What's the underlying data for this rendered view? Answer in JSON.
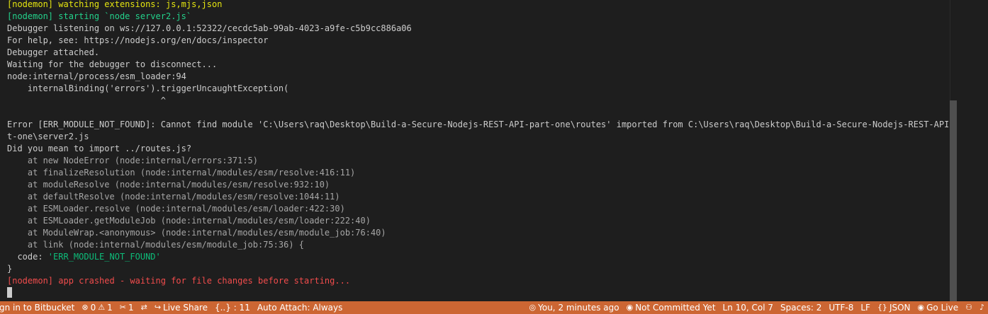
{
  "terminal": {
    "lines": [
      {
        "text": "[nodemon] watching extensions: js,mjs,json",
        "color": "#e5e510"
      },
      {
        "text": "[nodemon] starting `node server2.js`",
        "color": "#23d18b"
      },
      {
        "text": "Debugger listening on ws://127.0.0.1:52322/cecdc5ab-99ab-4023-a9fe-c5b9cc886a06",
        "color": "#cccccc"
      },
      {
        "text": "For help, see: https://nodejs.org/en/docs/inspector",
        "color": "#cccccc"
      },
      {
        "text": "Debugger attached.",
        "color": "#cccccc"
      },
      {
        "text": "Waiting for the debugger to disconnect...",
        "color": "#cccccc"
      },
      {
        "text": "node:internal/process/esm_loader:94",
        "color": "#cccccc"
      },
      {
        "text": "    internalBinding('errors').triggerUncaughtException(",
        "color": "#cccccc"
      },
      {
        "text": "                              ^",
        "color": "#cccccc"
      },
      {
        "text": "",
        "color": "#cccccc"
      },
      {
        "text": "Error [ERR_MODULE_NOT_FOUND]: Cannot find module 'C:\\Users\\raq\\Desktop\\Build-a-Secure-Nodejs-REST-API-part-one\\routes' imported from C:\\Users\\raq\\Desktop\\Build-a-Secure-Nodejs-REST-API-par",
        "color": "#cccccc"
      },
      {
        "text": "t-one\\server2.js",
        "color": "#cccccc"
      },
      {
        "text": "Did you mean to import ../routes.js?",
        "color": "#cccccc"
      },
      {
        "text": "    at new NodeError (node:internal/errors:371:5)",
        "color": "#a6a6a6"
      },
      {
        "text": "    at finalizeResolution (node:internal/modules/esm/resolve:416:11)",
        "color": "#a6a6a6"
      },
      {
        "text": "    at moduleResolve (node:internal/modules/esm/resolve:932:10)",
        "color": "#a6a6a6"
      },
      {
        "text": "    at defaultResolve (node:internal/modules/esm/resolve:1044:11)",
        "color": "#a6a6a6"
      },
      {
        "text": "    at ESMLoader.resolve (node:internal/modules/esm/loader:422:30)",
        "color": "#a6a6a6"
      },
      {
        "text": "    at ESMLoader.getModuleJob (node:internal/modules/esm/loader:222:40)",
        "color": "#a6a6a6"
      },
      {
        "text": "    at ModuleWrap.<anonymous> (node:internal/modules/esm/module_job:76:40)",
        "color": "#a6a6a6"
      },
      {
        "text": "    at link (node:internal/modules/esm/module_job:75:36) {",
        "color": "#a6a6a6"
      }
    ],
    "code_key": "  code: ",
    "code_value": "'ERR_MODULE_NOT_FOUND'",
    "closing_brace": "}",
    "crash_message": "[nodemon] app crashed - waiting for file changes before starting..."
  },
  "statusbar": {
    "signin": "gn in to Bitbucket",
    "errors_count": "0",
    "warnings_count": "1",
    "tools_count": "1",
    "live_share": "Live Share",
    "braces": "{..} : 11",
    "auto_attach": "Auto Attach: Always",
    "blame": "You, 2 minutes ago",
    "not_committed": "Not Committed Yet",
    "position": "Ln 10, Col 7",
    "spaces": "Spaces: 2",
    "encoding": "UTF-8",
    "eol": "LF",
    "language": "JSON",
    "go_live": "Go Live",
    "colors": {
      "background": "#cc6633",
      "terminal_bg": "#1e1e1e"
    }
  }
}
